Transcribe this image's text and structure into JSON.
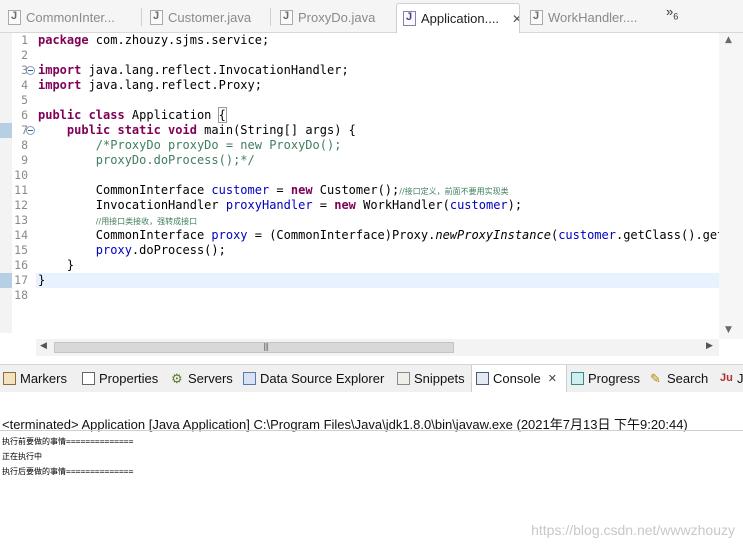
{
  "editor_tabs": [
    {
      "label": "CommonInter...",
      "active": false
    },
    {
      "label": "Customer.java",
      "active": false
    },
    {
      "label": "ProxyDo.java",
      "active": false
    },
    {
      "label": "Application....",
      "active": true,
      "close": "✕"
    },
    {
      "label": "WorkHandler....",
      "active": false
    }
  ],
  "overflow": {
    "symbol": "»",
    "count": "6"
  },
  "line_numbers": [
    "1",
    "2",
    "3",
    "4",
    "5",
    "6",
    "7",
    "8",
    "9",
    "10",
    "11",
    "12",
    "13",
    "14",
    "15",
    "16",
    "17",
    "18"
  ],
  "code": {
    "l1_kw": "package",
    "l1_rest": " com.zhouzy.sjms.service;",
    "l3_kw": "import",
    "l3_rest": " java.lang.reflect.InvocationHandler;",
    "l4_kw": "import",
    "l4_rest": " java.lang.reflect.Proxy;",
    "l6_kw": "public class",
    "l6_name": " Application ",
    "l6_brace": "{",
    "l7_indent": "    ",
    "l7_kw": "public static void",
    "l7_rest": " main(String[] args) {",
    "l8": "        /*ProxyDo proxyDo = new ProxyDo();",
    "l9": "        proxyDo.doProcess();*/",
    "l11_a": "        CommonInterface ",
    "l11_var": "customer",
    "l11_b": " = ",
    "l11_kw": "new",
    "l11_c": " Customer();",
    "l11_cm": "//接口定义，前面不要用实现类",
    "l12_a": "        InvocationHandler ",
    "l12_var": "proxyHandler",
    "l12_b": " = ",
    "l12_kw": "new",
    "l12_c": " WorkHandler(",
    "l12_var2": "customer",
    "l12_d": ");",
    "l13_indent": "        ",
    "l13_cm": "//用接口类接收，强转成接口",
    "l14_a": "        CommonInterface ",
    "l14_var": "proxy",
    "l14_b": " = (CommonInterface)Proxy.",
    "l14_method": "newProxyInstance",
    "l14_c": "(",
    "l14_var2": "customer",
    "l14_d": ".getClass().getClassLoader()",
    "l15_a": "        ",
    "l15_var": "proxy",
    "l15_b": ".doProcess();",
    "l16": "    }",
    "l17": "}"
  },
  "view_tabs": [
    {
      "label": "Markers"
    },
    {
      "label": "Properties"
    },
    {
      "label": "Servers"
    },
    {
      "label": "Data Source Explorer"
    },
    {
      "label": "Snippets"
    },
    {
      "label": "Console",
      "close": "✕"
    },
    {
      "label": "Progress"
    },
    {
      "label": "Search"
    },
    {
      "label": "J"
    }
  ],
  "console": {
    "status": "<terminated> Application [Java Application] C:\\Program Files\\Java\\jdk1.8.0\\bin\\javaw.exe (2021年7月13日 下午9:20:44)",
    "lines": [
      "执行前要做的事情==============",
      "正在执行中",
      "执行后要做的事情=============="
    ]
  },
  "watermark": "https://blog.csdn.net/wwwzhouzy",
  "colors": {
    "keyword": "#7f0055",
    "comment": "#3f7f5f",
    "field": "#0000c0",
    "current_line": "#e8f2fe"
  }
}
